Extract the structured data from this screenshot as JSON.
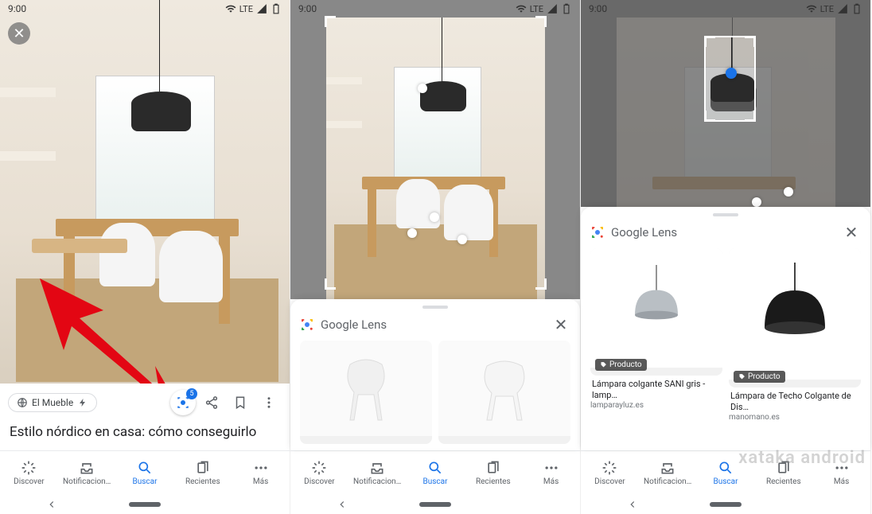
{
  "status": {
    "time": "9:00",
    "network": "LTE"
  },
  "screen1": {
    "source_chip": "El Mueble",
    "lens_badge": "5",
    "caption": "Estilo nórdico en casa: cómo conseguirlo"
  },
  "screen2": {
    "sheet_title": "Google Lens"
  },
  "screen3": {
    "sheet_title": "Google Lens",
    "product_badge": "Producto",
    "results": [
      {
        "title": "Lámpara colgante SANI gris - lamp…",
        "source": "lamparayluz.es"
      },
      {
        "title": "Lámpara de Techo Colgante de Dis…",
        "source": "manomano.es"
      }
    ]
  },
  "nav": {
    "items": [
      {
        "label": "Discover"
      },
      {
        "label": "Notificacion…"
      },
      {
        "label": "Buscar"
      },
      {
        "label": "Recientes"
      },
      {
        "label": "Más"
      }
    ]
  },
  "watermark": "xataka android"
}
